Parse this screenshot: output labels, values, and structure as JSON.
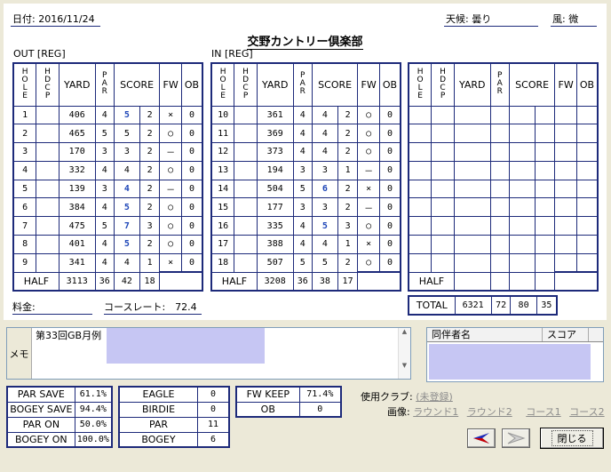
{
  "header": {
    "date": "日付: 2016/11/24",
    "weather": "天候: 曇り",
    "wind": "風: 微",
    "course_name": "交野カントリー倶楽部",
    "out_label": "OUT [REG]",
    "in_label": "IN [REG]"
  },
  "columns": {
    "hole": "HOLE",
    "hdcp": "HDCP",
    "yard": "YARD",
    "par": "PAR",
    "score": "SCORE",
    "fw": "FW",
    "ob": "OB"
  },
  "out_holes": [
    {
      "hole": "1",
      "hdcp": "",
      "yard": "406",
      "par": "4",
      "score": "5",
      "putts": "2",
      "fw": "×",
      "ob": "0",
      "blue": true
    },
    {
      "hole": "2",
      "hdcp": "",
      "yard": "465",
      "par": "5",
      "score": "5",
      "putts": "2",
      "fw": "○",
      "ob": "0",
      "blue": false
    },
    {
      "hole": "3",
      "hdcp": "",
      "yard": "170",
      "par": "3",
      "score": "3",
      "putts": "2",
      "fw": "－",
      "ob": "0",
      "blue": false
    },
    {
      "hole": "4",
      "hdcp": "",
      "yard": "332",
      "par": "4",
      "score": "4",
      "putts": "2",
      "fw": "○",
      "ob": "0",
      "blue": false
    },
    {
      "hole": "5",
      "hdcp": "",
      "yard": "139",
      "par": "3",
      "score": "4",
      "putts": "2",
      "fw": "－",
      "ob": "0",
      "blue": true
    },
    {
      "hole": "6",
      "hdcp": "",
      "yard": "384",
      "par": "4",
      "score": "5",
      "putts": "2",
      "fw": "○",
      "ob": "0",
      "blue": true
    },
    {
      "hole": "7",
      "hdcp": "",
      "yard": "475",
      "par": "5",
      "score": "7",
      "putts": "3",
      "fw": "○",
      "ob": "0",
      "blue": true
    },
    {
      "hole": "8",
      "hdcp": "",
      "yard": "401",
      "par": "4",
      "score": "5",
      "putts": "2",
      "fw": "○",
      "ob": "0",
      "blue": true
    },
    {
      "hole": "9",
      "hdcp": "",
      "yard": "341",
      "par": "4",
      "score": "4",
      "putts": "1",
      "fw": "×",
      "ob": "0",
      "blue": false
    }
  ],
  "in_holes": [
    {
      "hole": "10",
      "hdcp": "",
      "yard": "361",
      "par": "4",
      "score": "4",
      "putts": "2",
      "fw": "○",
      "ob": "0",
      "blue": false
    },
    {
      "hole": "11",
      "hdcp": "",
      "yard": "369",
      "par": "4",
      "score": "4",
      "putts": "2",
      "fw": "○",
      "ob": "0",
      "blue": false
    },
    {
      "hole": "12",
      "hdcp": "",
      "yard": "373",
      "par": "4",
      "score": "4",
      "putts": "2",
      "fw": "○",
      "ob": "0",
      "blue": false
    },
    {
      "hole": "13",
      "hdcp": "",
      "yard": "194",
      "par": "3",
      "score": "3",
      "putts": "1",
      "fw": "－",
      "ob": "0",
      "blue": false
    },
    {
      "hole": "14",
      "hdcp": "",
      "yard": "504",
      "par": "5",
      "score": "6",
      "putts": "2",
      "fw": "×",
      "ob": "0",
      "blue": true
    },
    {
      "hole": "15",
      "hdcp": "",
      "yard": "177",
      "par": "3",
      "score": "3",
      "putts": "2",
      "fw": "－",
      "ob": "0",
      "blue": false
    },
    {
      "hole": "16",
      "hdcp": "",
      "yard": "335",
      "par": "4",
      "score": "5",
      "putts": "3",
      "fw": "○",
      "ob": "0",
      "blue": true
    },
    {
      "hole": "17",
      "hdcp": "",
      "yard": "388",
      "par": "4",
      "score": "4",
      "putts": "1",
      "fw": "×",
      "ob": "0",
      "blue": false
    },
    {
      "hole": "18",
      "hdcp": "",
      "yard": "507",
      "par": "5",
      "score": "5",
      "putts": "2",
      "fw": "○",
      "ob": "0",
      "blue": false
    }
  ],
  "out_half": {
    "label": "HALF",
    "yard": "3113",
    "par": "36",
    "score": "42",
    "putts": "18"
  },
  "in_half": {
    "label": "HALF",
    "yard": "3208",
    "par": "36",
    "score": "38",
    "putts": "17"
  },
  "third_half": {
    "label": "HALF"
  },
  "total": {
    "label": "TOTAL",
    "yard": "6321",
    "par": "72",
    "score": "80",
    "putts": "35"
  },
  "fee_label": "料金:",
  "course_rate": "コースレート:　72.4",
  "memo": {
    "label": "メモ",
    "text": "第33回GB月例"
  },
  "companions": {
    "name_header": "同伴者名",
    "score_header": "スコア"
  },
  "stats_left": [
    {
      "k": "PAR SAVE",
      "v": "61.1%"
    },
    {
      "k": "BOGEY SAVE",
      "v": "94.4%"
    },
    {
      "k": "PAR ON",
      "v": "50.0%"
    },
    {
      "k": "BOGEY ON",
      "v": "100.0%"
    }
  ],
  "stats_mid": [
    {
      "k": "EAGLE",
      "v": "0"
    },
    {
      "k": "BIRDIE",
      "v": "0"
    },
    {
      "k": "PAR",
      "v": "11"
    },
    {
      "k": "BOGEY",
      "v": "6"
    }
  ],
  "stats_right": [
    {
      "k": "FW KEEP",
      "v": "71.4%"
    },
    {
      "k": "OB",
      "v": "0"
    }
  ],
  "clubs": {
    "label": "使用クラブ:",
    "value": "(未登録)",
    "image_label": "画像:",
    "round1": "ラウンド1",
    "round2": "ラウンド2",
    "course1": "コース1",
    "course2": "コース2"
  },
  "buttons": {
    "close": "閉じる"
  }
}
